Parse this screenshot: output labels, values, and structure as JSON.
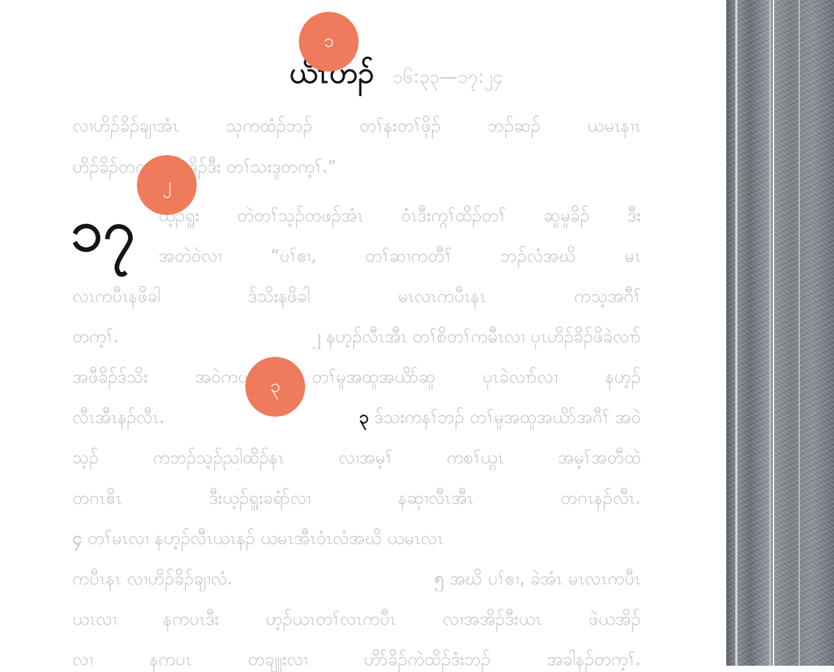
{
  "header": {
    "book_name": "ယိၤဟၣ်",
    "reference": "၁၆:၃၃—၁၇:၂၄"
  },
  "chapter": "၁၇",
  "lines": [
    "လၢဟိၣ်ခိၣ်ချၢအံၤ သုကထံၣ်ဘၣ် တၢ်နးတၢ်ဖှိၣ် ဘၣ်ဆၣ် ယမၤနၢၤ",
    "ဟိၣ်ခိၣ်တက့ၢ် ဆိအိၣ်ဒီး တၢ်သးဒူတက့ၢ်.”",
    "ယ့ၣ်ရှူး တဲတၢ်သ့ၣ်တဖၣ်အံၤ ဝံၤဒီးကွၢ်ထိၣ်တၢ် ဆူမူခိၣ် ဒီး",
    "အတဲဝဲလၢ “ပၢ်ဧၢ, တၢ်ဆၢကတီၢ် ဘၣ်လံအဃိ မၤ",
    "လၤကပီၤနဖိခါ ဒ်သိးနဖိခါ မၤလၤကပီၤနၤ ကသ့အဂီၢ်",
    "တက့ၢ်.",
    "နဟ့ၣ်လီၤအီၤ တၢ်စိတၢ်ကမီၤလၢ ပှၤဟိၣ်ခိၣ်ဖိခဲလၢာ်",
    "အဖီခိၣ်ဒ်သိး အဝဲကဟ့ၣ် တၢ်မူအထူအယိာ်ဆူ ပှၤခဲလၢာ်လၢ နဟ့ၣ်",
    "လီၤအီၤနၣ်လီၤ.",
    "ဒ်သးကနၢ်ဘၣ် တၢ်မူအထူအယိာ်အဂီၢ် အဝဲ",
    "သ့ၣ် ကဘၣ်သ့ၣ်ညါထိၣ်နၤ လၢအမ့ၢ် ကစၢ်ယွၤ အမ့ၢ်အတီထဲ",
    "တဂၤဧိၤ ဒီးယ့ၣ်ရှူးခရံာ်လၢ နဆှၢလီၤအီၤ တဂၤနၣ်လီၤ.",
    "တၢ်မၤလၢ နဟ့ၣ်လီၤယၤနၣ် ယမၤအီၤဝံၤလံအဃိ ယမၤလၤ",
    "ကပီၤနၤ လၢဟိၣ်ခိၣ်ချၢလံ.",
    "အဃိ ပၢ်ဧၢ, ခဲအံၤ မၤလၤကပီၤ",
    "ယၤလၢ နကပၤဒီး ဟ့ၣ်ယၤတၢ်လၤကပီၤ လၢအအိၣ်ဒီးယၤ ဖဲယအိၣ်",
    "လၢ နကပၤ တချူးလၢ ဟိာ်ခိၣ်ကဲထိၣ်ဒံးဘၣ် အခါနၣ်တက့ၢ်."
  ],
  "verses": {
    "v2": "၂",
    "v3": "၃",
    "v4": "၄",
    "v5": "၅"
  },
  "badges": [
    "၁",
    "၂",
    "၃"
  ],
  "colors": {
    "badge": "#ef7b5c",
    "faded_text": "#c3c7cb",
    "dark_text": "#151515",
    "cover": "#7c8388"
  }
}
